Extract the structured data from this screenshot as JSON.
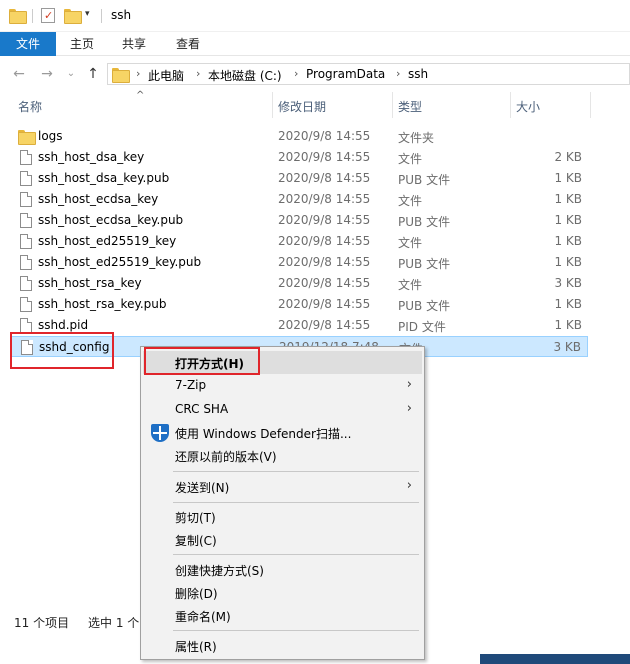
{
  "window": {
    "title": "ssh"
  },
  "ribbon": {
    "tabs": [
      "文件",
      "主页",
      "共享",
      "查看"
    ]
  },
  "nav": {
    "back_icon": "arrow-left-icon",
    "forward_icon": "arrow-right-icon",
    "recent_icon": "chevron-down-icon",
    "up_icon": "arrow-up-icon",
    "breadcrumbs": [
      "此电脑",
      "本地磁盘 (C:)",
      "ProgramData",
      "ssh"
    ]
  },
  "columns": {
    "name": "名称",
    "date": "修改日期",
    "type": "类型",
    "size": "大小"
  },
  "files": [
    {
      "name": "logs",
      "date": "2020/9/8 14:55",
      "type": "文件夹",
      "size": "",
      "kind": "folder"
    },
    {
      "name": "ssh_host_dsa_key",
      "date": "2020/9/8 14:55",
      "type": "文件",
      "size": "2 KB",
      "kind": "file"
    },
    {
      "name": "ssh_host_dsa_key.pub",
      "date": "2020/9/8 14:55",
      "type": "PUB 文件",
      "size": "1 KB",
      "kind": "file"
    },
    {
      "name": "ssh_host_ecdsa_key",
      "date": "2020/9/8 14:55",
      "type": "文件",
      "size": "1 KB",
      "kind": "file"
    },
    {
      "name": "ssh_host_ecdsa_key.pub",
      "date": "2020/9/8 14:55",
      "type": "PUB 文件",
      "size": "1 KB",
      "kind": "file"
    },
    {
      "name": "ssh_host_ed25519_key",
      "date": "2020/9/8 14:55",
      "type": "文件",
      "size": "1 KB",
      "kind": "file"
    },
    {
      "name": "ssh_host_ed25519_key.pub",
      "date": "2020/9/8 14:55",
      "type": "PUB 文件",
      "size": "1 KB",
      "kind": "file"
    },
    {
      "name": "ssh_host_rsa_key",
      "date": "2020/9/8 14:55",
      "type": "文件",
      "size": "3 KB",
      "kind": "file"
    },
    {
      "name": "ssh_host_rsa_key.pub",
      "date": "2020/9/8 14:55",
      "type": "PUB 文件",
      "size": "1 KB",
      "kind": "file"
    },
    {
      "name": "sshd.pid",
      "date": "2020/9/8 14:55",
      "type": "PID 文件",
      "size": "1 KB",
      "kind": "file"
    },
    {
      "name": "sshd_config",
      "date": "2019/12/18 7:48",
      "type": "文件",
      "size": "3 KB",
      "kind": "file",
      "selected": true
    }
  ],
  "status": {
    "count": "11 个项目",
    "selection": "选中 1 个"
  },
  "context_menu": {
    "items": [
      {
        "label": "打开方式(H)",
        "bold": true,
        "highlight": true
      },
      {
        "label": "7-Zip",
        "submenu": true
      },
      {
        "label": "CRC SHA",
        "submenu": true
      },
      {
        "label": "使用 Windows Defender扫描...",
        "icon": "defender-shield-icon"
      },
      {
        "label": "还原以前的版本(V)"
      },
      {
        "label": "发送到(N)",
        "submenu": true
      },
      {
        "label": "剪切(T)"
      },
      {
        "label": "复制(C)"
      },
      {
        "label": "创建快捷方式(S)"
      },
      {
        "label": "删除(D)"
      },
      {
        "label": "重命名(M)"
      },
      {
        "label": "属性(R)"
      }
    ]
  },
  "colors": {
    "accent": "#1979ca",
    "selection": "#cce8ff",
    "highlight_box": "#e0252b"
  }
}
